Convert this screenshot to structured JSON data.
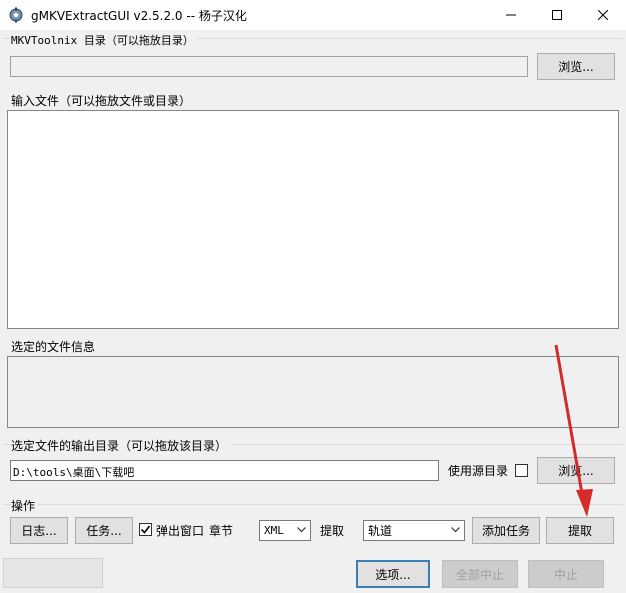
{
  "window": {
    "title": "gMKVExtractGUI v2.5.2.0 -- 杨子汉化",
    "app_icon": "gear-film-icon"
  },
  "toolnix": {
    "label": "MKVToolnix 目录（可以拖放目录）",
    "value": "",
    "browse_label": "浏览..."
  },
  "input": {
    "label": "输入文件（可以拖放文件或目录）"
  },
  "info": {
    "label": "选定的文件信息"
  },
  "output": {
    "label": "选定文件的输出目录（可以拖放该目录）",
    "value": "D:\\tools\\桌面\\下载吧",
    "use_source_label": "使用源目录",
    "use_source_checked": false,
    "browse_label": "浏览..."
  },
  "actions": {
    "label": "操作",
    "log_label": "日志...",
    "tasks_label": "任务...",
    "popup_label": "弹出窗口",
    "popup_checked": true,
    "chapter_label": "章节",
    "chapter_format": "XML",
    "extract_label": "提取",
    "extract_type": "轨道",
    "add_task_label": "添加任务",
    "extract_button_label": "提取"
  },
  "footer": {
    "options_label": "选项...",
    "abort_all_label": "全部中止",
    "abort_label": "中止"
  },
  "colors": {
    "accent": "#3c7fb1",
    "annotation_arrow": "#d42a2a"
  }
}
